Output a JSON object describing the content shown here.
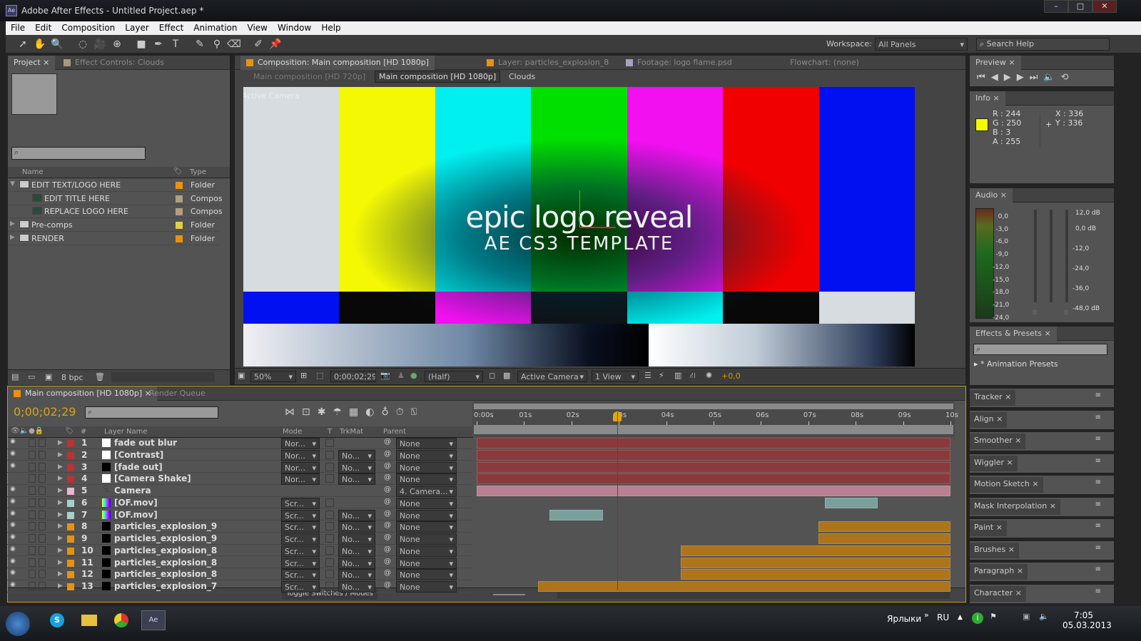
{
  "window": {
    "title": "Adobe After Effects - Untitled Project.aep *",
    "minimize": "–",
    "maximize": "□",
    "close": "✕"
  },
  "menu": [
    "File",
    "Edit",
    "Composition",
    "Layer",
    "Effect",
    "Animation",
    "View",
    "Window",
    "Help"
  ],
  "toolbar": {
    "tools": [
      "selection-tool",
      "hand-tool",
      "zoom-tool",
      "rotation-tool",
      "camera-tool",
      "pan-behind-tool",
      "rectangle-tool",
      "pen-tool",
      "type-tool",
      "brush-tool",
      "clone-stamp-tool",
      "eraser-tool",
      "roto-brush-tool",
      "puppet-pin-tool"
    ],
    "workspace_label": "Workspace:",
    "workspace_value": "All Panels",
    "search_placeholder": "Search Help"
  },
  "project": {
    "tab": "Project",
    "effect_tab": "Effect Controls: Clouds",
    "col_name": "Name",
    "col_type": "Type",
    "bpc": "8 bpc",
    "items": [
      {
        "name": "EDIT TEXT/LOGO HERE",
        "type": "Folder",
        "label": "#e8920f",
        "indent": 0,
        "kind": "folder",
        "open": true
      },
      {
        "name": "EDIT TITLE HERE",
        "type": "Compos",
        "label": "#b0a080",
        "indent": 1,
        "kind": "comp"
      },
      {
        "name": "REPLACE LOGO HERE",
        "type": "Compos",
        "label": "#b0a080",
        "indent": 1,
        "kind": "comp"
      },
      {
        "name": "Pre-comps",
        "type": "Folder",
        "label": "#e0d040",
        "indent": 0,
        "kind": "folder"
      },
      {
        "name": "RENDER",
        "type": "Folder",
        "label": "#e8920f",
        "indent": 0,
        "kind": "folder"
      }
    ]
  },
  "viewer": {
    "tabs": [
      "Composition: Main composition [HD 1080p]",
      "Layer: particles_explosion_8",
      "Footage: logo flame.psd",
      "Flowchart: (none)"
    ],
    "breadcrumbs": [
      "Main composition [HD 720p]",
      "Main composition [HD 1080p]",
      "Clouds"
    ],
    "camera_label": "Active Camera",
    "logo_line1": "epic logo reveal",
    "logo_line2": "AE CS3 TEMPLATE",
    "zoom": "50%",
    "timecode": "0;00;02;29",
    "resolution": "(Half)",
    "camera": "Active Camera",
    "views": "1 View",
    "exposure": "+0,0",
    "top_bars": [
      "#d6dce0",
      "#f4f803",
      "#00f0f0",
      "#00e000",
      "#f010f0",
      "#f00000",
      "#0010f0"
    ],
    "mid_bars": [
      "#0010f0",
      "#080808",
      "#f010f0",
      "#101010",
      "#00f0f0",
      "#080808",
      "#d6dce0"
    ]
  },
  "preview": {
    "tab": "Preview"
  },
  "info": {
    "tab": "Info",
    "r": "R : 244",
    "g": "G : 250",
    "b": "B : 3",
    "a": "A :  255",
    "x": "X : 336",
    "y": "Y : 336",
    "color": "#f4fa03"
  },
  "audio": {
    "tab": "Audio",
    "left_scale": [
      "0,0",
      "-3,0",
      "-6,0",
      "-9,0",
      "-12,0",
      "-15,0",
      "-18,0",
      "-21,0",
      "-24,0"
    ],
    "right_scale": [
      "12,0 dB",
      "0,0 dB",
      "-12,0",
      "-24,0",
      "-36,0",
      "-48,0 dB"
    ],
    "slider_values": [
      "0",
      "0"
    ]
  },
  "effects": {
    "tab": "Effects & Presets",
    "search_placeholder": "",
    "first_item": "* Animation Presets"
  },
  "right_panels": [
    "Tracker",
    "Align",
    "Smoother",
    "Wiggler",
    "Motion Sketch",
    "Mask Interpolation",
    "Paint",
    "Brushes",
    "Paragraph",
    "Character"
  ],
  "timeline": {
    "tab": "Main composition [HD 1080p]",
    "render_tab": "Render Queue",
    "timecode": "0;00;02;29",
    "headers": {
      "num": "#",
      "name": "Layer Name",
      "mode": "Mode",
      "t": "T",
      "trkmat": "TrkMat",
      "parent": "Parent"
    },
    "toggle": "Toggle Switches / Modes",
    "ruler": [
      "0:00s",
      "01s",
      "02s",
      "03s",
      "04s",
      "05s",
      "06s",
      "07s",
      "08s",
      "09s",
      "10s"
    ],
    "current_time_s": 2.97,
    "duration_s": 10,
    "layers": [
      {
        "n": "1",
        "name": "fade out blur",
        "label": "#c03030",
        "src": "white",
        "mode": "Nor...",
        "trkmat": "",
        "parent": "None",
        "eye": true,
        "start": 0,
        "end": 10,
        "bar": "#8a3a3c"
      },
      {
        "n": "2",
        "name": "[Contrast]",
        "label": "#c03030",
        "src": "white",
        "mode": "Nor...",
        "trkmat": "No...",
        "parent": "None",
        "eye": true,
        "start": 0,
        "end": 10,
        "bar": "#8a3a3c"
      },
      {
        "n": "3",
        "name": "[fade out]",
        "label": "#c03030",
        "src": "black",
        "mode": "Nor...",
        "trkmat": "No...",
        "parent": "None",
        "eye": true,
        "start": 0,
        "end": 10,
        "bar": "#8a3a3c"
      },
      {
        "n": "4",
        "name": "[Camera Shake]",
        "label": "#c03030",
        "src": "white",
        "mode": "Nor...",
        "trkmat": "No...",
        "parent": "None",
        "eye": false,
        "start": 0,
        "end": 10,
        "bar": "#8a3a3c"
      },
      {
        "n": "5",
        "name": "Camera",
        "label": "#e8b8c8",
        "src": "camera",
        "mode": "",
        "trkmat": "",
        "parent": "4. Camera...",
        "eye": true,
        "start": 0,
        "end": 10,
        "bar": "#b88090"
      },
      {
        "n": "6",
        "name": "[OF.mov]",
        "label": "#a8d0c8",
        "src": "bars",
        "mode": "Scr...",
        "trkmat": "",
        "parent": "None",
        "eye": true,
        "start": 7.35,
        "end": 8.47,
        "bar": "#7aa09c"
      },
      {
        "n": "7",
        "name": "[OF.mov]",
        "label": "#a8d0c8",
        "src": "bars",
        "mode": "Scr...",
        "trkmat": "No...",
        "parent": "None",
        "eye": true,
        "start": 1.53,
        "end": 2.66,
        "bar": "#7aa09c"
      },
      {
        "n": "8",
        "name": "particles_explosion_9",
        "label": "#e8920f",
        "src": "black",
        "mode": "Scr...",
        "trkmat": "No...",
        "parent": "None",
        "eye": true,
        "start": 7.22,
        "end": 10,
        "bar": "#ad741c"
      },
      {
        "n": "9",
        "name": "particles_explosion_9",
        "label": "#e8920f",
        "src": "black",
        "mode": "Scr...",
        "trkmat": "No...",
        "parent": "None",
        "eye": true,
        "start": 7.22,
        "end": 10,
        "bar": "#ad741c"
      },
      {
        "n": "10",
        "name": "particles_explosion_8",
        "label": "#e8920f",
        "src": "black",
        "mode": "Scr...",
        "trkmat": "No...",
        "parent": "None",
        "eye": true,
        "start": 4.3,
        "end": 10,
        "bar": "#ad741c"
      },
      {
        "n": "11",
        "name": "particles_explosion_8",
        "label": "#e8920f",
        "src": "black",
        "mode": "Scr...",
        "trkmat": "No...",
        "parent": "None",
        "eye": true,
        "start": 4.3,
        "end": 10,
        "bar": "#ad741c"
      },
      {
        "n": "12",
        "name": "particles_explosion_8",
        "label": "#e8920f",
        "src": "black",
        "mode": "Scr...",
        "trkmat": "No...",
        "parent": "None",
        "eye": true,
        "start": 4.3,
        "end": 10,
        "bar": "#ad741c"
      },
      {
        "n": "13",
        "name": "particles_explosion_7",
        "label": "#e8920f",
        "src": "black",
        "mode": "Scr...",
        "trkmat": "No...",
        "parent": "None",
        "eye": true,
        "start": 1.3,
        "end": 10,
        "bar": "#ad741c"
      }
    ]
  },
  "taskbar": {
    "shortcuts": "Ярлыки",
    "lang": "RU",
    "time": "7:05",
    "date": "05.03.2013"
  }
}
